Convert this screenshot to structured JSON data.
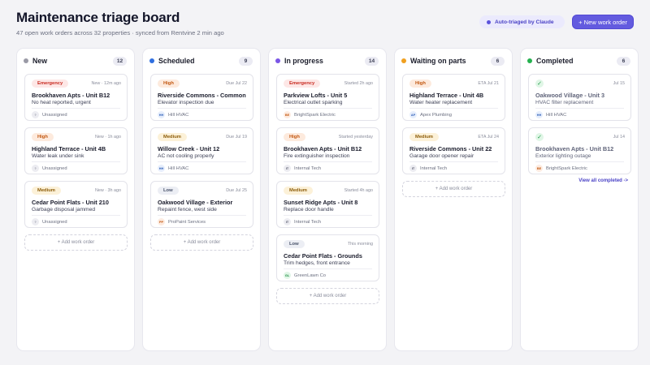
{
  "header": {
    "title": "Maintenance triage board",
    "subtitle": "47 open work orders across 32 properties · synced from Rentvine 2 min ago",
    "auto_badge": "Auto-triaged by Claude",
    "new_button": "+ New work order"
  },
  "add_label": "+ Add work order",
  "view_all": "View all completed ->",
  "colors": {
    "accent": "#635bdf",
    "new": "#9a9aa6",
    "scheduled": "#2f6fe0",
    "in_progress": "#7a55e6",
    "waiting": "#f0a020",
    "completed": "#25b14f"
  },
  "columns": [
    {
      "title": "New",
      "count": "12",
      "dot": "#9a9aa6",
      "cards": [
        {
          "priority": "Emergency",
          "meta": "New · 12m ago",
          "title": "Brookhaven Apts - Unit B12",
          "desc": "No heat reported, urgent",
          "avatar": "?",
          "assignee": "Unassigned"
        },
        {
          "priority": "High",
          "meta": "New · 1h ago",
          "title": "Highland Terrace - Unit 4B",
          "desc": "Water leak under sink",
          "avatar": "?",
          "assignee": "Unassigned"
        },
        {
          "priority": "Medium",
          "meta": "New · 3h ago",
          "title": "Cedar Point Flats - Unit 210",
          "desc": "Garbage disposal jammed",
          "avatar": "?",
          "assignee": "Unassigned"
        }
      ]
    },
    {
      "title": "Scheduled",
      "count": "9",
      "dot": "#2f6fe0",
      "cards": [
        {
          "priority": "High",
          "meta": "Due Jul 22",
          "title": "Riverside Commons - Common",
          "desc": "Elevator inspection due",
          "avatar": "HH",
          "assignee": "Hill HVAC"
        },
        {
          "priority": "Medium",
          "meta": "Due Jul 19",
          "title": "Willow Creek - Unit 12",
          "desc": "AC not cooling properly",
          "avatar": "HH",
          "assignee": "Hill HVAC"
        },
        {
          "priority": "Low",
          "meta": "Due Jul 25",
          "title": "Oakwood Village - Exterior",
          "desc": "Repaint fence, west side",
          "avatar": "PP",
          "assignee": "ProPaint Services"
        }
      ]
    },
    {
      "title": "In progress",
      "count": "14",
      "dot": "#7a55e6",
      "cards": [
        {
          "priority": "Emergency",
          "meta": "Started 2h ago",
          "title": "Parkview Lofts - Unit 5",
          "desc": "Electrical outlet sparking",
          "avatar": "BE",
          "assignee": "BrightSpark Electric"
        },
        {
          "priority": "High",
          "meta": "Started yesterday",
          "title": "Brookhaven Apts - Unit B12",
          "desc": "Fire extinguisher inspection",
          "avatar": "IT",
          "assignee": "Internal Tech"
        },
        {
          "priority": "Medium",
          "meta": "Started 4h ago",
          "title": "Sunset Ridge Apts - Unit 8",
          "desc": "Replace door handle",
          "avatar": "IT",
          "assignee": "Internal Tech"
        },
        {
          "priority": "Low",
          "meta": "This morning",
          "title": "Cedar Point Flats - Grounds",
          "desc": "Trim hedges, front entrance",
          "avatar": "GL",
          "assignee": "GreenLawn Co"
        }
      ]
    },
    {
      "title": "Waiting on parts",
      "count": "6",
      "dot": "#f0a020",
      "cards": [
        {
          "priority": "High",
          "meta": "ETA Jul 21",
          "title": "Highland Terrace - Unit 4B",
          "desc": "Water heater replacement",
          "avatar": "AP",
          "assignee": "Apex Plumbing"
        },
        {
          "priority": "Medium",
          "meta": "ETA Jul 24",
          "title": "Riverside Commons - Unit 22",
          "desc": "Garage door opener repair",
          "avatar": "IT",
          "assignee": "Internal Tech"
        }
      ]
    },
    {
      "title": "Completed",
      "count": "6",
      "dot": "#25b14f",
      "cards": [
        {
          "priority": "done",
          "meta": "Jul 15",
          "title": "Oakwood Village - Unit 3",
          "desc": "HVAC filter replacement",
          "avatar": "HH",
          "assignee": "Hill HVAC"
        },
        {
          "priority": "done",
          "meta": "Jul 14",
          "title": "Brookhaven Apts - Unit B12",
          "desc": "Exterior lighting outage",
          "avatar": "BE",
          "assignee": "BrightSpark Electric"
        }
      ]
    }
  ]
}
